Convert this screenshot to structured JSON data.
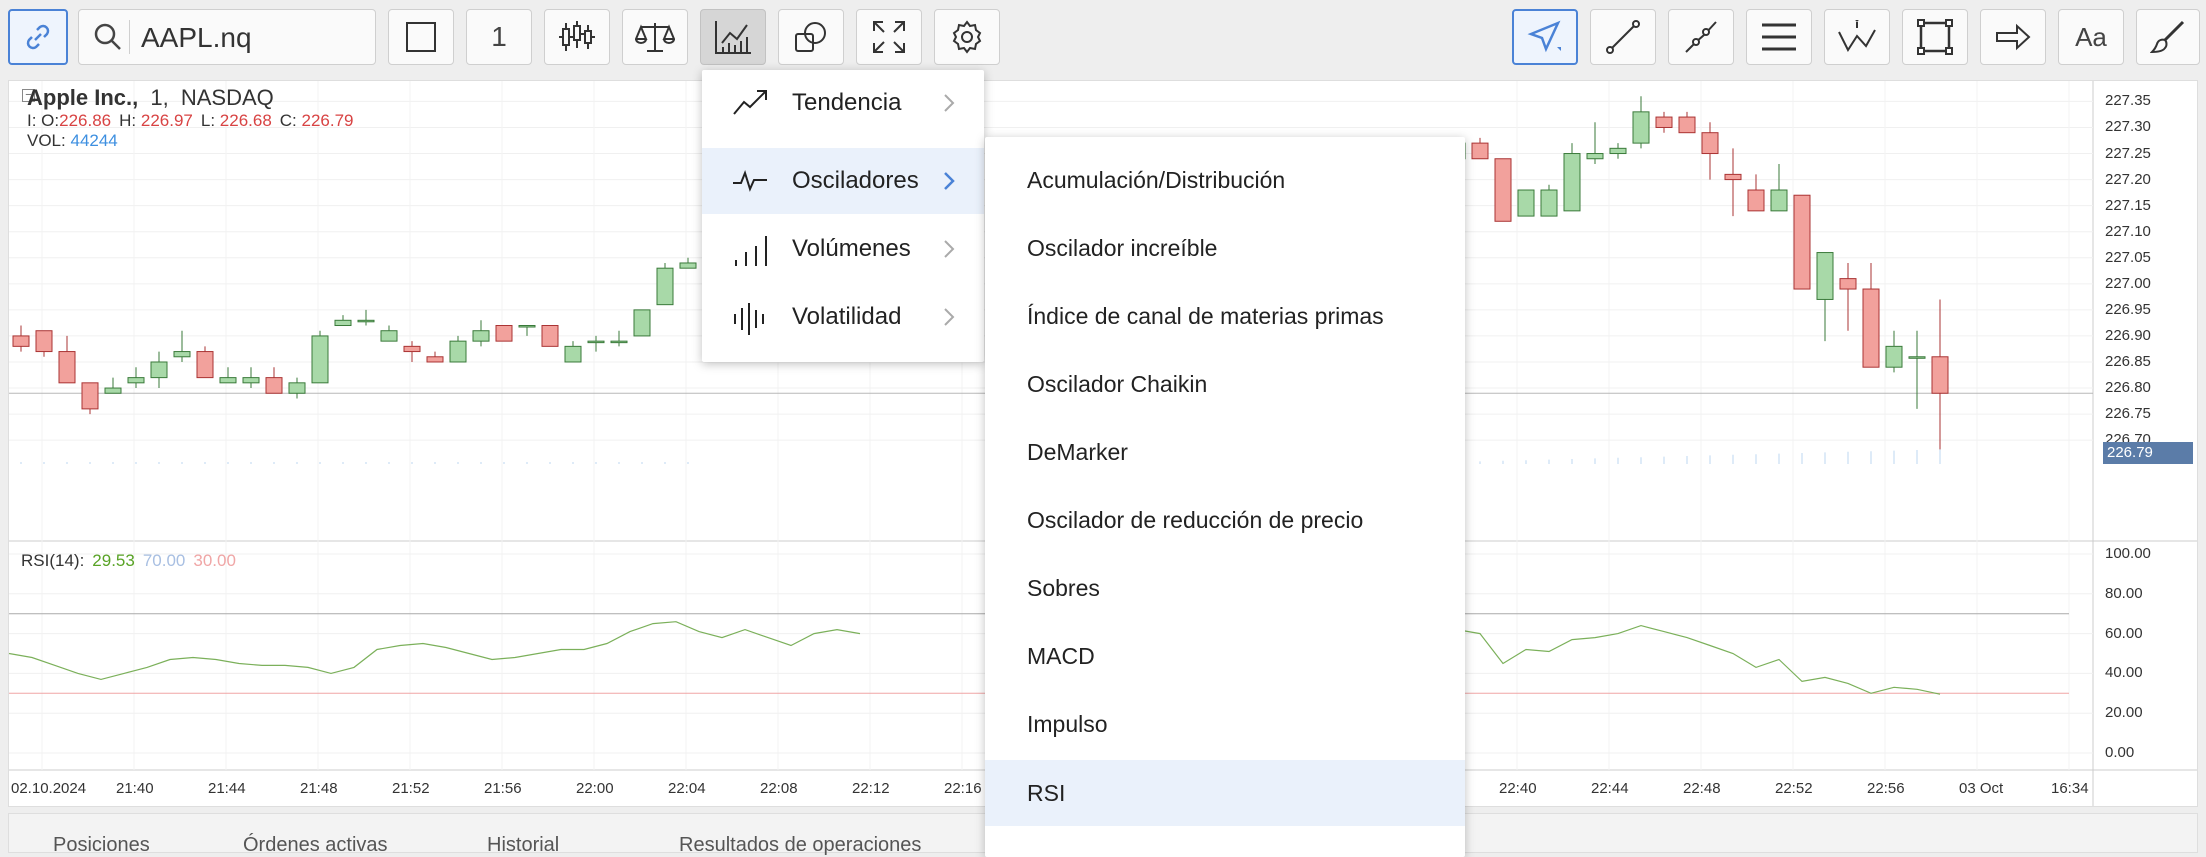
{
  "toolbar": {
    "search_value": "AAPL.nq",
    "interval_value": "1",
    "font_button_label": "Aa",
    "icons": [
      "link-icon",
      "search-icon",
      "square-icon",
      "candles-icon",
      "scales-icon",
      "indicators-icon",
      "shapes-icon",
      "fullscreen-icon",
      "gear-icon",
      "cursor-icon",
      "line-icon",
      "polyline-icon",
      "horizontal-lines-icon",
      "annotation-icon",
      "rectangle-icon",
      "arrow-icon",
      "brush-icon"
    ]
  },
  "legend": {
    "name": "Apple Inc.,",
    "interval": "1,",
    "exchange": "NASDAQ",
    "o_label": "I: O:",
    "o": "226.86",
    "h_label": "H:",
    "h": "226.97",
    "l_label": "L:",
    "l": "226.68",
    "c_label": "C:",
    "c": "226.79",
    "vol_label": "VOL:",
    "vol": "44244"
  },
  "rsi_legend": {
    "label": "RSI(14):",
    "value": "29.53",
    "upper": "70.00",
    "lower": "30.00"
  },
  "price_axis": [
    "227.35",
    "227.30",
    "227.25",
    "227.20",
    "227.15",
    "227.10",
    "227.05",
    "227.00",
    "226.95",
    "226.90",
    "226.85",
    "226.80",
    "226.75",
    "226.70"
  ],
  "current_price": "226.79",
  "rsi_axis": [
    "100.00",
    "80.00",
    "60.00",
    "40.00",
    "20.00",
    "0.00"
  ],
  "time_axis": [
    "02.10.2024",
    "21:40",
    "21:44",
    "21:48",
    "21:52",
    "21:56",
    "22:00",
    "22:04",
    "22:08",
    "22:12",
    "22:16",
    "22:40",
    "22:44",
    "22:48",
    "22:52",
    "22:56",
    "03 Oct",
    "16:34"
  ],
  "bottom_tabs": [
    "Posiciones",
    "Órdenes activas",
    "Historial",
    "Resultados de operaciones"
  ],
  "menu_categories": [
    {
      "label": "Tendencia",
      "icon": "trend-icon"
    },
    {
      "label": "Osciladores",
      "icon": "oscillator-icon",
      "selected": true
    },
    {
      "label": "Volúmenes",
      "icon": "volumes-icon"
    },
    {
      "label": "Volatilidad",
      "icon": "volatility-icon"
    }
  ],
  "oscillator_items": [
    "Acumulación/Distribución",
    "Oscilador increíble",
    "Índice de canal de materias primas",
    "Oscilador Chaikin",
    "DeMarker",
    "Oscilador de reducción de precio",
    "Sobres",
    "MACD",
    "Impulso",
    "RSI"
  ],
  "chart_data": {
    "type": "candlestick",
    "price_range": [
      226.66,
      227.37
    ],
    "current_price": 226.79,
    "candles_left": [
      {
        "o": 226.9,
        "c": 226.88,
        "h": 226.92,
        "l": 226.87
      },
      {
        "o": 226.91,
        "c": 226.87,
        "h": 226.91,
        "l": 226.86
      },
      {
        "o": 226.87,
        "c": 226.81,
        "h": 226.9,
        "l": 226.81
      },
      {
        "o": 226.81,
        "c": 226.76,
        "h": 226.81,
        "l": 226.75
      },
      {
        "o": 226.79,
        "c": 226.8,
        "h": 226.82,
        "l": 226.79
      },
      {
        "o": 226.81,
        "c": 226.82,
        "h": 226.84,
        "l": 226.8
      },
      {
        "o": 226.82,
        "c": 226.85,
        "h": 226.87,
        "l": 226.8
      },
      {
        "o": 226.86,
        "c": 226.87,
        "h": 226.91,
        "l": 226.85
      },
      {
        "o": 226.87,
        "c": 226.82,
        "h": 226.88,
        "l": 226.82
      },
      {
        "o": 226.81,
        "c": 226.82,
        "h": 226.84,
        "l": 226.81
      },
      {
        "o": 226.81,
        "c": 226.82,
        "h": 226.84,
        "l": 226.8
      },
      {
        "o": 226.82,
        "c": 226.79,
        "h": 226.84,
        "l": 226.79
      },
      {
        "o": 226.79,
        "c": 226.81,
        "h": 226.82,
        "l": 226.78
      },
      {
        "o": 226.81,
        "c": 226.9,
        "h": 226.91,
        "l": 226.81
      },
      {
        "o": 226.92,
        "c": 226.93,
        "h": 226.94,
        "l": 226.92
      },
      {
        "o": 226.93,
        "c": 226.93,
        "h": 226.95,
        "l": 226.92
      },
      {
        "o": 226.89,
        "c": 226.91,
        "h": 226.92,
        "l": 226.89
      },
      {
        "o": 226.88,
        "c": 226.87,
        "h": 226.89,
        "l": 226.85
      },
      {
        "o": 226.86,
        "c": 226.85,
        "h": 226.87,
        "l": 226.85
      },
      {
        "o": 226.85,
        "c": 226.89,
        "h": 226.9,
        "l": 226.85
      },
      {
        "o": 226.89,
        "c": 226.91,
        "h": 226.93,
        "l": 226.88
      },
      {
        "o": 226.92,
        "c": 226.89,
        "h": 226.92,
        "l": 226.89
      },
      {
        "o": 226.92,
        "c": 226.92,
        "h": 226.92,
        "l": 226.9
      },
      {
        "o": 226.92,
        "c": 226.88,
        "h": 226.92,
        "l": 226.88
      },
      {
        "o": 226.85,
        "c": 226.88,
        "h": 226.89,
        "l": 226.85
      },
      {
        "o": 226.89,
        "c": 226.89,
        "h": 226.9,
        "l": 226.87
      },
      {
        "o": 226.89,
        "c": 226.89,
        "h": 226.91,
        "l": 226.88
      },
      {
        "o": 226.9,
        "c": 226.95,
        "h": 226.95,
        "l": 226.9
      },
      {
        "o": 226.96,
        "c": 227.03,
        "h": 227.04,
        "l": 226.96
      },
      {
        "o": 227.03,
        "c": 227.04,
        "h": 227.05,
        "l": 227.03
      }
    ],
    "candles_right": [
      {
        "o": 227.24,
        "c": 227.27,
        "h": 227.28,
        "l": 227.22
      },
      {
        "o": 227.27,
        "c": 227.24,
        "h": 227.28,
        "l": 227.24
      },
      {
        "o": 227.24,
        "c": 227.12,
        "h": 227.24,
        "l": 227.12
      },
      {
        "o": 227.13,
        "c": 227.18,
        "h": 227.18,
        "l": 227.13
      },
      {
        "o": 227.13,
        "c": 227.18,
        "h": 227.19,
        "l": 227.13
      },
      {
        "o": 227.14,
        "c": 227.25,
        "h": 227.27,
        "l": 227.14
      },
      {
        "o": 227.24,
        "c": 227.25,
        "h": 227.31,
        "l": 227.23
      },
      {
        "o": 227.25,
        "c": 227.26,
        "h": 227.27,
        "l": 227.24
      },
      {
        "o": 227.27,
        "c": 227.33,
        "h": 227.36,
        "l": 227.26
      },
      {
        "o": 227.32,
        "c": 227.3,
        "h": 227.33,
        "l": 227.29
      },
      {
        "o": 227.32,
        "c": 227.29,
        "h": 227.33,
        "l": 227.29
      },
      {
        "o": 227.29,
        "c": 227.25,
        "h": 227.31,
        "l": 227.2
      },
      {
        "o": 227.21,
        "c": 227.2,
        "h": 227.26,
        "l": 227.13
      },
      {
        "o": 227.18,
        "c": 227.14,
        "h": 227.21,
        "l": 227.14
      },
      {
        "o": 227.14,
        "c": 227.18,
        "h": 227.23,
        "l": 227.14
      },
      {
        "o": 227.17,
        "c": 226.99,
        "h": 227.17,
        "l": 226.99
      },
      {
        "o": 226.97,
        "c": 227.06,
        "h": 227.06,
        "l": 226.89
      },
      {
        "o": 227.01,
        "c": 226.99,
        "h": 227.04,
        "l": 226.91
      },
      {
        "o": 226.99,
        "c": 226.84,
        "h": 227.04,
        "l": 226.84
      },
      {
        "o": 226.84,
        "c": 226.88,
        "h": 226.91,
        "l": 226.83
      },
      {
        "o": 226.86,
        "c": 226.86,
        "h": 226.91,
        "l": 226.76
      },
      {
        "o": 226.86,
        "c": 226.79,
        "h": 226.97,
        "l": 226.68
      }
    ],
    "rsi": {
      "upper": 70,
      "lower": 30,
      "values_left": [
        50,
        48,
        44,
        40,
        37,
        40,
        43,
        47,
        48,
        47,
        45,
        44,
        44,
        43,
        40,
        43,
        52,
        54,
        55,
        53,
        50,
        47,
        48,
        50,
        52,
        52,
        55,
        61,
        65,
        66,
        61,
        58,
        62,
        58,
        54,
        60,
        62,
        60
      ],
      "values_right": [
        62,
        60,
        45,
        52,
        51,
        57,
        58,
        60,
        64,
        61,
        58,
        54,
        50,
        43,
        47,
        36,
        38,
        35,
        30,
        33,
        32,
        29.53
      ]
    }
  }
}
